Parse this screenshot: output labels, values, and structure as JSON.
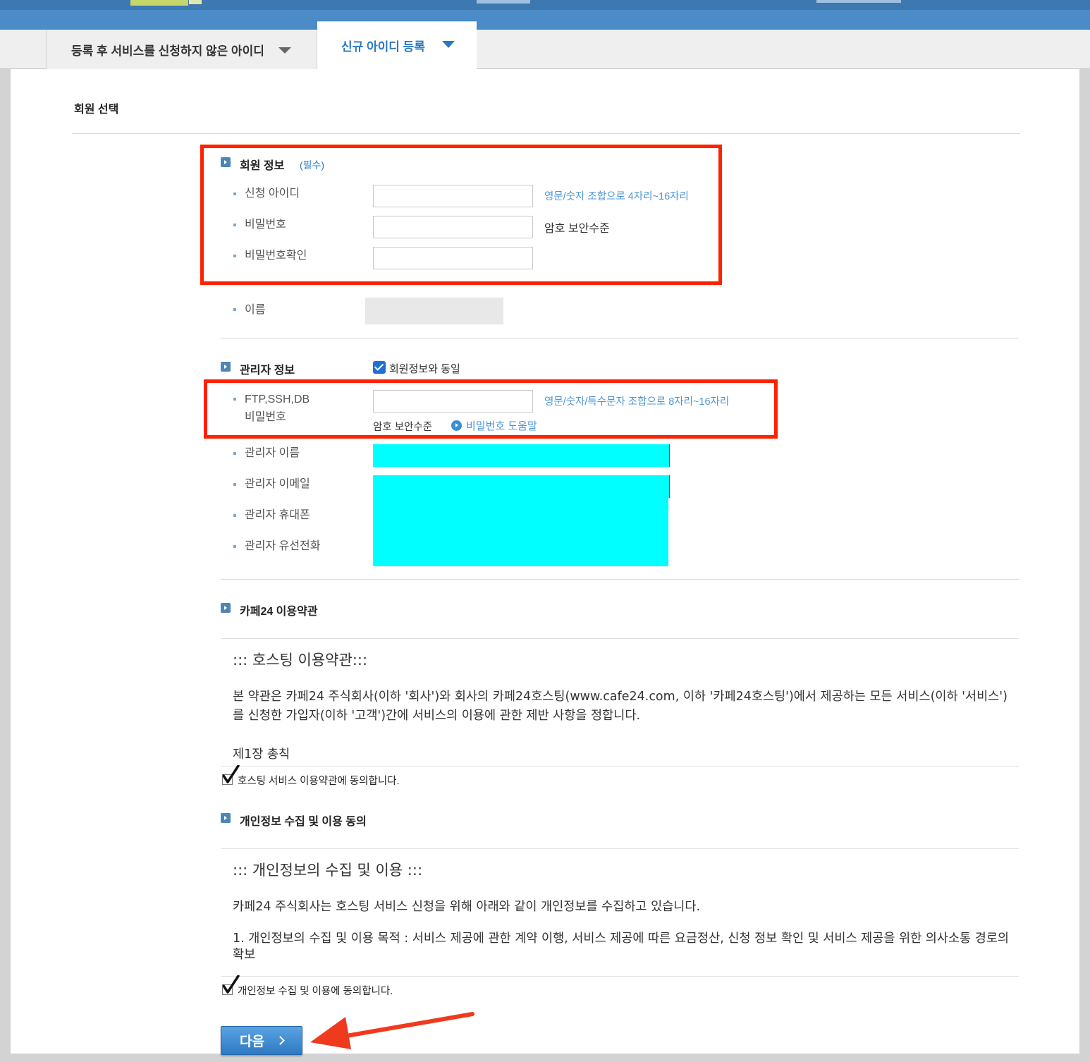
{
  "tabs": [
    {
      "label": "등록 후 서비스를 신청하지 않은 아이디"
    },
    {
      "label": "신규 아이디 등록"
    }
  ],
  "section_title": "회원 선택",
  "member_info": {
    "title": "회원 정보",
    "required": "(필수)",
    "fields": {
      "user_id": {
        "label": "신청 아이디",
        "hint": "영문/숫자 조합으로 4자리~16자리",
        "value": ""
      },
      "password": {
        "label": "비밀번호",
        "note": "암호 보안수준",
        "value": ""
      },
      "password_confirm": {
        "label": "비밀번호확인",
        "value": ""
      },
      "name": {
        "label": "이름"
      }
    }
  },
  "admin_info": {
    "title": "관리자 정보",
    "same_as_member": {
      "label": "회원정보와 동일",
      "checked": true
    },
    "ftp_password": {
      "label_line1": "FTP,SSH,DB",
      "label_line2": "비밀번호",
      "hint": "영문/숫자/특수문자 조합으로 8자리~16자리",
      "strength": "암호 보안수준",
      "help_link": "비밀번호 도움말"
    },
    "admin_name": {
      "label": "관리자 이름"
    },
    "admin_email": {
      "label": "관리자 이메일"
    },
    "admin_mobile": {
      "label": "관리자 휴대폰"
    },
    "admin_phone": {
      "label": "관리자 유선전화"
    },
    "redaction_color": "#00ffff"
  },
  "terms": {
    "title": "카페24 이용약관",
    "box_title": "::: 호스팅 이용약관:::",
    "paragraph": "본 약관은 카페24 주식회사(이하 '회사')와 회사의 카페24호스팅(www.cafe24.com, 이하 '카페24호스팅')에서 제공하는 모든 서비스(이하 '서비스')를 신청한 가입자(이하 '고객')간에 서비스의 이용에 관한 제반 사항을 정합니다.",
    "chapter": "제1장 총칙",
    "agree_label": "호스팅 서비스 이용약관에 동의합니다.",
    "agreed": true
  },
  "privacy": {
    "title": "개인정보 수집 및 이용 동의",
    "box_title": "::: 개인정보의 수집 및 이용 :::",
    "paragraph1": "카페24 주식회사는 호스팅 서비스 신청을 위해 아래와 같이 개인정보를 수집하고 있습니다.",
    "paragraph2": "1. 개인정보의 수집 및 이용 목적 : 서비스 제공에 관한 계약 이행, 서비스 제공에 따른 요금정산, 신청 정보 확인 및 서비스 제공을 위한 의사소통 경로의 확보",
    "agree_label": "개인정보 수집 및 이용에 동의합니다.",
    "agreed": true
  },
  "next_button": {
    "label": "다음"
  },
  "colors": {
    "accent": "#2b79c2",
    "hint": "#4d95d4",
    "annotation_red": "#ff2200",
    "header_blue": "#4a8bc8"
  },
  "icons": [
    "chevron-down-icon",
    "section-bullet-icon",
    "checkbox-checked-icon",
    "help-arrow-icon",
    "checkmark-icon",
    "chevron-right-icon",
    "red-arrow-icon"
  ]
}
